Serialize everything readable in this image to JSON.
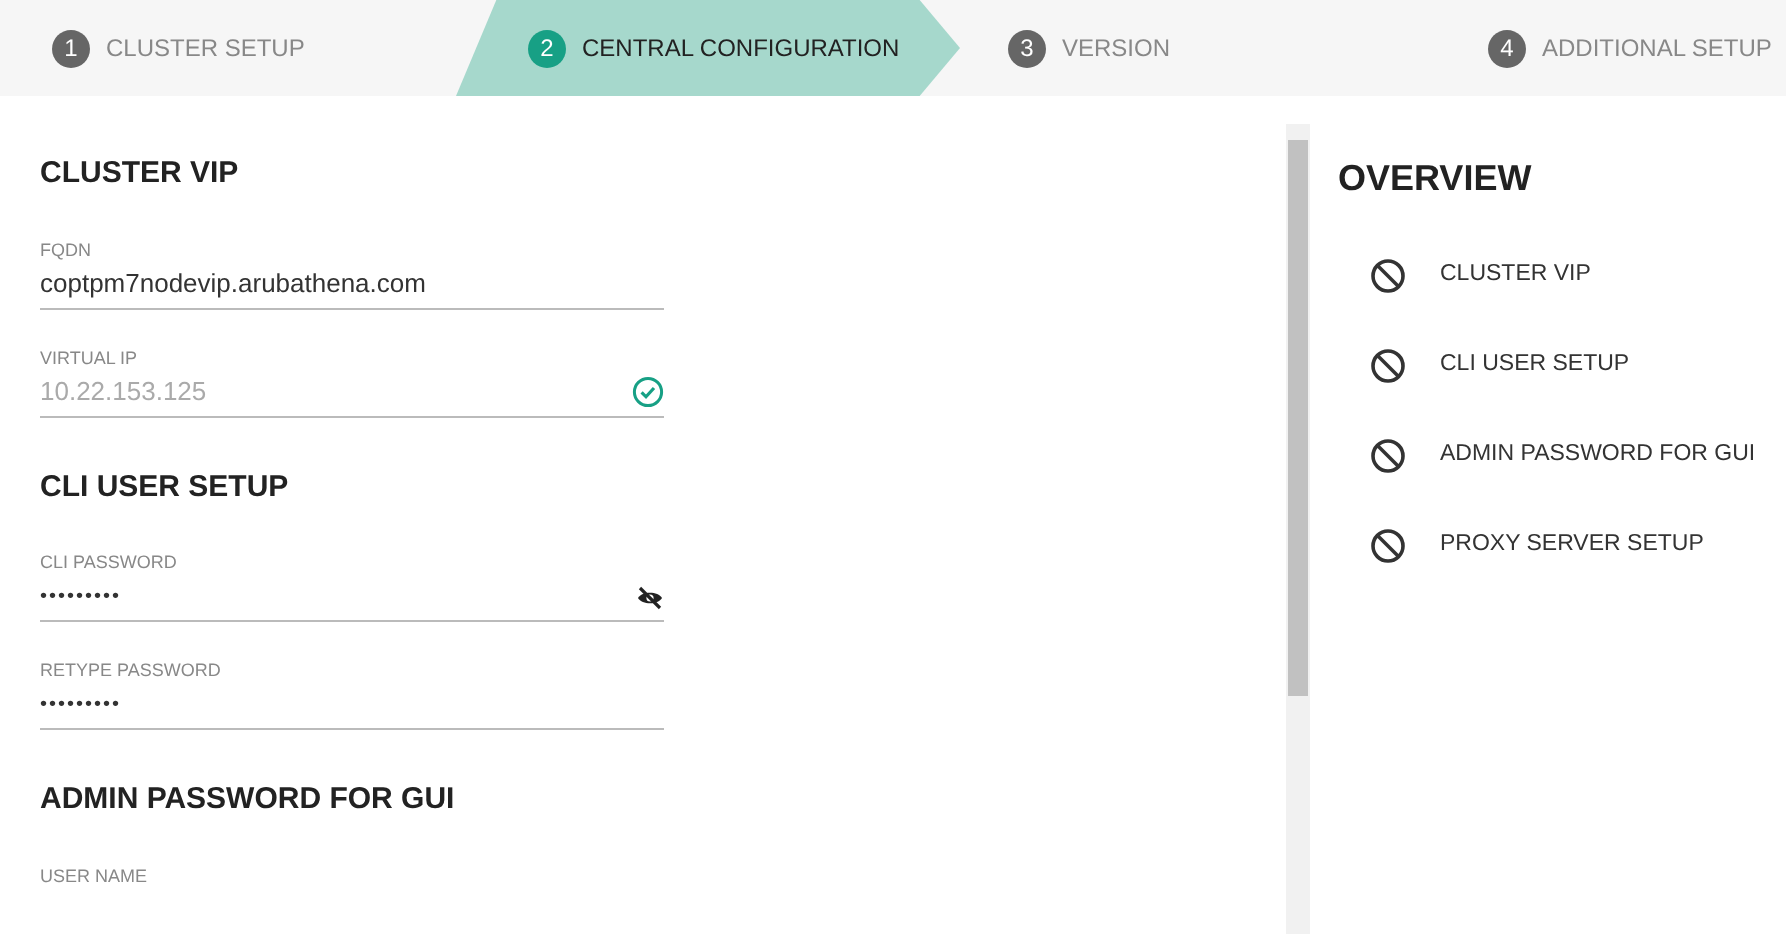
{
  "steps": [
    {
      "number": "1",
      "label": "CLUSTER SETUP",
      "selected": false
    },
    {
      "number": "2",
      "label": "CENTRAL CONFIGURATION",
      "selected": true
    },
    {
      "number": "3",
      "label": "VERSION",
      "selected": false
    },
    {
      "number": "4",
      "label": "ADDITIONAL SETUP",
      "selected": false
    }
  ],
  "sections": [
    {
      "title": "CLUSTER VIP",
      "fields": [
        {
          "kind": "text",
          "label": "FQDN",
          "value": "coptpm7nodevip.arubathena.com",
          "disabled": false,
          "valid": false
        },
        {
          "kind": "text",
          "label": "VIRTUAL IP",
          "value": "10.22.153.125",
          "disabled": true,
          "valid": true
        }
      ]
    },
    {
      "title": "CLI USER SETUP",
      "fields": [
        {
          "kind": "password",
          "label": "CLI PASSWORD",
          "value": "•••••••••",
          "reveal_toggle": true
        },
        {
          "kind": "password",
          "label": "RETYPE PASSWORD",
          "value": "•••••••••",
          "reveal_toggle": false
        }
      ]
    },
    {
      "title": "ADMIN PASSWORD FOR GUI",
      "fields": [
        {
          "kind": "label_only",
          "label": "USER NAME"
        }
      ]
    }
  ],
  "overview": {
    "title": "OVERVIEW",
    "items": [
      {
        "label": "CLUSTER VIP",
        "done": false
      },
      {
        "label": "CLI USER SETUP",
        "done": false
      },
      {
        "label": "ADMIN PASSWORD FOR GUI",
        "done": false
      },
      {
        "label": "PROXY SERVER SETUP",
        "done": false
      }
    ]
  }
}
